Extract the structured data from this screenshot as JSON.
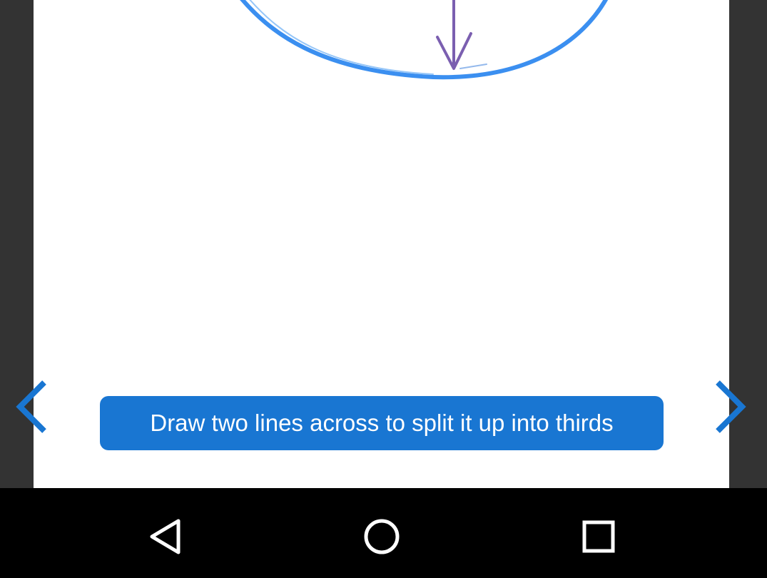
{
  "caption": {
    "text": "Draw two lines across to split it up into thirds"
  },
  "navigation": {
    "prev_icon": "chevron-left-icon",
    "next_icon": "chevron-right-icon"
  },
  "system_nav": {
    "back_icon": "back-triangle-icon",
    "home_icon": "home-circle-icon",
    "recents_icon": "recents-square-icon"
  },
  "colors": {
    "accent": "#1976d2",
    "circle_stroke": "#3b8ff0",
    "arrow_stroke": "#7b5fb0",
    "side_background": "#333333",
    "navbar_background": "#000000"
  }
}
